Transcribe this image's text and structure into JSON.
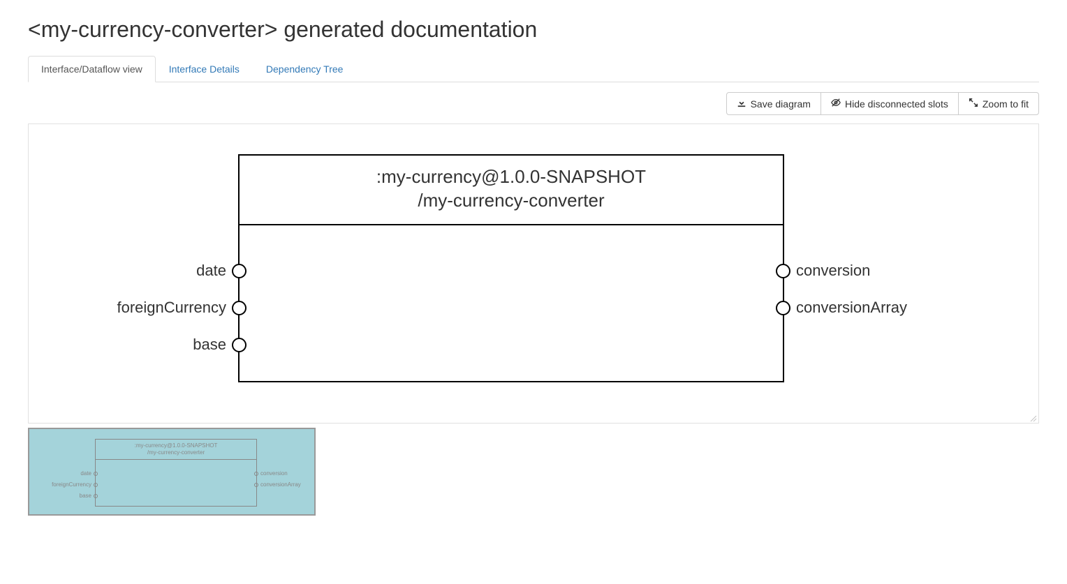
{
  "page_title": "<my-currency-converter> generated documentation",
  "tabs": {
    "dataflow": "Interface/Dataflow view",
    "details": "Interface Details",
    "deps": "Dependency Tree"
  },
  "toolbar": {
    "save": "Save diagram",
    "hide": "Hide disconnected slots",
    "zoomfit": "Zoom to fit"
  },
  "diagram": {
    "node": {
      "title_line1": ":my-currency@1.0.0-SNAPSHOT",
      "title_line2": "/my-currency-converter",
      "inputs": [
        "date",
        "foreignCurrency",
        "base"
      ],
      "outputs": [
        "conversion",
        "conversionArray"
      ]
    }
  }
}
